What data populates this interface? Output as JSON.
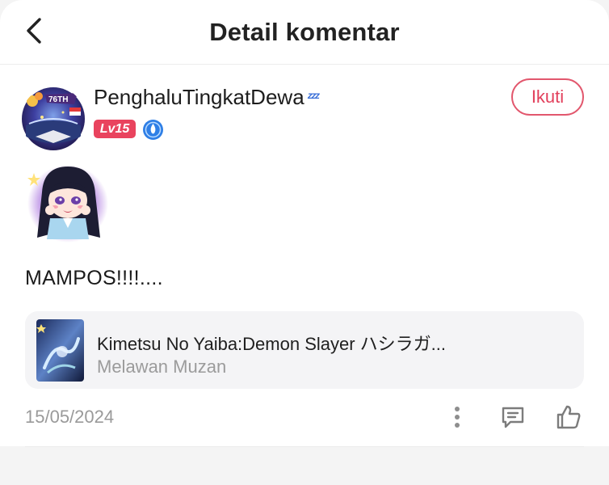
{
  "header": {
    "title": "Detail komentar",
    "back_icon": "chevron-left-icon"
  },
  "comment": {
    "user": {
      "name": "PenghaluTingkatDewa",
      "name_suffix": "ᶻᶻᶻ",
      "level": "Lv15",
      "avatar_badge_text": "76TH",
      "follow_label": "Ikuti"
    },
    "text": "MAMPOS!!!!....",
    "date": "15/05/2024",
    "reference": {
      "title": "Kimetsu No Yaiba:Demon Slayer ハシラガ...",
      "subtitle": "Melawan Muzan"
    },
    "actions": [
      "more-vertical-icon",
      "reply-comment-icon",
      "thumbs-up-icon"
    ]
  },
  "colors": {
    "accent": "#e2405c",
    "level_badge": "#e9435e",
    "rank_icon": "#2f7fe6",
    "muted_text": "#9a9a9a"
  }
}
